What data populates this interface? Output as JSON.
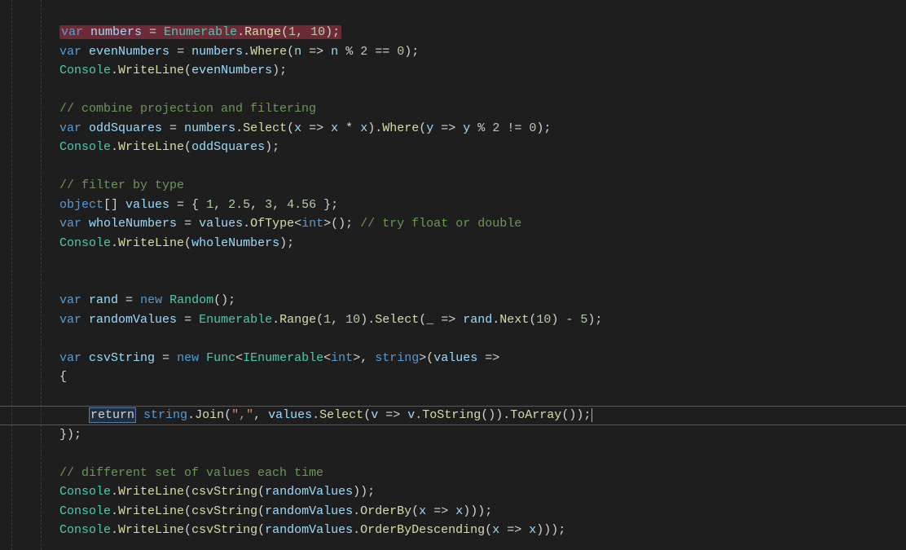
{
  "editor": {
    "language": "csharp",
    "highlight_line_index": 20,
    "lines": [
      [
        {
          "cls": "hl-error",
          "tokens": [
            {
              "cls": "tok-kw",
              "t": "var"
            },
            {
              "cls": "tok-plain",
              "t": " "
            },
            {
              "cls": "tok-id",
              "t": "numbers"
            },
            {
              "cls": "tok-plain",
              "t": " = "
            },
            {
              "cls": "tok-type",
              "t": "Enumerable"
            },
            {
              "cls": "tok-plain",
              "t": "."
            },
            {
              "cls": "tok-method",
              "t": "Range"
            },
            {
              "cls": "tok-plain",
              "t": "("
            },
            {
              "cls": "tok-num",
              "t": "1"
            },
            {
              "cls": "tok-plain",
              "t": ", "
            },
            {
              "cls": "tok-num",
              "t": "10"
            },
            {
              "cls": "tok-plain",
              "t": ");"
            }
          ]
        }
      ],
      [
        {
          "cls": "tok-kw",
          "t": "var"
        },
        {
          "cls": "tok-plain",
          "t": " "
        },
        {
          "cls": "tok-id",
          "t": "evenNumbers"
        },
        {
          "cls": "tok-plain",
          "t": " = "
        },
        {
          "cls": "tok-id",
          "t": "numbers"
        },
        {
          "cls": "tok-plain",
          "t": "."
        },
        {
          "cls": "tok-method",
          "t": "Where"
        },
        {
          "cls": "tok-plain",
          "t": "("
        },
        {
          "cls": "tok-id",
          "t": "n"
        },
        {
          "cls": "tok-plain",
          "t": " => "
        },
        {
          "cls": "tok-id",
          "t": "n"
        },
        {
          "cls": "tok-plain",
          "t": " % "
        },
        {
          "cls": "tok-num",
          "t": "2"
        },
        {
          "cls": "tok-plain",
          "t": " == "
        },
        {
          "cls": "tok-num",
          "t": "0"
        },
        {
          "cls": "tok-plain",
          "t": ");"
        }
      ],
      [
        {
          "cls": "tok-type",
          "t": "Console"
        },
        {
          "cls": "tok-plain",
          "t": "."
        },
        {
          "cls": "tok-method",
          "t": "WriteLine"
        },
        {
          "cls": "tok-plain",
          "t": "("
        },
        {
          "cls": "tok-id",
          "t": "evenNumbers"
        },
        {
          "cls": "tok-plain",
          "t": ");"
        }
      ],
      [],
      [
        {
          "cls": "tok-comment",
          "t": "// combine projection and filtering"
        }
      ],
      [
        {
          "cls": "tok-kw",
          "t": "var"
        },
        {
          "cls": "tok-plain",
          "t": " "
        },
        {
          "cls": "tok-id",
          "t": "oddSquares"
        },
        {
          "cls": "tok-plain",
          "t": " = "
        },
        {
          "cls": "tok-id",
          "t": "numbers"
        },
        {
          "cls": "tok-plain",
          "t": "."
        },
        {
          "cls": "tok-method",
          "t": "Select"
        },
        {
          "cls": "tok-plain",
          "t": "("
        },
        {
          "cls": "tok-id",
          "t": "x"
        },
        {
          "cls": "tok-plain",
          "t": " => "
        },
        {
          "cls": "tok-id",
          "t": "x"
        },
        {
          "cls": "tok-plain",
          "t": " * "
        },
        {
          "cls": "tok-id",
          "t": "x"
        },
        {
          "cls": "tok-plain",
          "t": ")."
        },
        {
          "cls": "tok-method",
          "t": "Where"
        },
        {
          "cls": "tok-plain",
          "t": "("
        },
        {
          "cls": "tok-id",
          "t": "y"
        },
        {
          "cls": "tok-plain",
          "t": " => "
        },
        {
          "cls": "tok-id",
          "t": "y"
        },
        {
          "cls": "tok-plain",
          "t": " % "
        },
        {
          "cls": "tok-num",
          "t": "2"
        },
        {
          "cls": "tok-plain",
          "t": " != "
        },
        {
          "cls": "tok-num",
          "t": "0"
        },
        {
          "cls": "tok-plain",
          "t": ");"
        }
      ],
      [
        {
          "cls": "tok-type",
          "t": "Console"
        },
        {
          "cls": "tok-plain",
          "t": "."
        },
        {
          "cls": "tok-method",
          "t": "WriteLine"
        },
        {
          "cls": "tok-plain",
          "t": "("
        },
        {
          "cls": "tok-id",
          "t": "oddSquares"
        },
        {
          "cls": "tok-plain",
          "t": ");"
        }
      ],
      [],
      [
        {
          "cls": "tok-comment",
          "t": "// filter by type"
        }
      ],
      [
        {
          "cls": "tok-kw",
          "t": "object"
        },
        {
          "cls": "tok-plain",
          "t": "[] "
        },
        {
          "cls": "tok-id",
          "t": "values"
        },
        {
          "cls": "tok-plain",
          "t": " = { "
        },
        {
          "cls": "tok-num",
          "t": "1"
        },
        {
          "cls": "tok-plain",
          "t": ", "
        },
        {
          "cls": "tok-num",
          "t": "2.5"
        },
        {
          "cls": "tok-plain",
          "t": ", "
        },
        {
          "cls": "tok-num",
          "t": "3"
        },
        {
          "cls": "tok-plain",
          "t": ", "
        },
        {
          "cls": "tok-num",
          "t": "4.56"
        },
        {
          "cls": "tok-plain",
          "t": " };"
        }
      ],
      [
        {
          "cls": "tok-kw",
          "t": "var"
        },
        {
          "cls": "tok-plain",
          "t": " "
        },
        {
          "cls": "tok-id",
          "t": "wholeNumbers"
        },
        {
          "cls": "tok-plain",
          "t": " = "
        },
        {
          "cls": "tok-id",
          "t": "values"
        },
        {
          "cls": "tok-plain",
          "t": "."
        },
        {
          "cls": "tok-method",
          "t": "OfType"
        },
        {
          "cls": "tok-plain",
          "t": "<"
        },
        {
          "cls": "tok-kw",
          "t": "int"
        },
        {
          "cls": "tok-plain",
          "t": ">(); "
        },
        {
          "cls": "tok-comment",
          "t": "// try float or double"
        }
      ],
      [
        {
          "cls": "tok-type",
          "t": "Console"
        },
        {
          "cls": "tok-plain",
          "t": "."
        },
        {
          "cls": "tok-method",
          "t": "WriteLine"
        },
        {
          "cls": "tok-plain",
          "t": "("
        },
        {
          "cls": "tok-id",
          "t": "wholeNumbers"
        },
        {
          "cls": "tok-plain",
          "t": ");"
        }
      ],
      [],
      [],
      [
        {
          "cls": "tok-kw",
          "t": "var"
        },
        {
          "cls": "tok-plain",
          "t": " "
        },
        {
          "cls": "tok-id",
          "t": "rand"
        },
        {
          "cls": "tok-plain",
          "t": " = "
        },
        {
          "cls": "tok-kw",
          "t": "new"
        },
        {
          "cls": "tok-plain",
          "t": " "
        },
        {
          "cls": "tok-type",
          "t": "Random"
        },
        {
          "cls": "tok-plain",
          "t": "();"
        }
      ],
      [
        {
          "cls": "tok-kw",
          "t": "var"
        },
        {
          "cls": "tok-plain",
          "t": " "
        },
        {
          "cls": "tok-id",
          "t": "randomValues"
        },
        {
          "cls": "tok-plain",
          "t": " = "
        },
        {
          "cls": "tok-type",
          "t": "Enumerable"
        },
        {
          "cls": "tok-plain",
          "t": "."
        },
        {
          "cls": "tok-method",
          "t": "Range"
        },
        {
          "cls": "tok-plain",
          "t": "("
        },
        {
          "cls": "tok-num",
          "t": "1"
        },
        {
          "cls": "tok-plain",
          "t": ", "
        },
        {
          "cls": "tok-num",
          "t": "10"
        },
        {
          "cls": "tok-plain",
          "t": ")."
        },
        {
          "cls": "tok-method",
          "t": "Select"
        },
        {
          "cls": "tok-plain",
          "t": "("
        },
        {
          "cls": "tok-id",
          "t": "_"
        },
        {
          "cls": "tok-plain",
          "t": " => "
        },
        {
          "cls": "tok-id",
          "t": "rand"
        },
        {
          "cls": "tok-plain",
          "t": "."
        },
        {
          "cls": "tok-method",
          "t": "Next"
        },
        {
          "cls": "tok-plain",
          "t": "("
        },
        {
          "cls": "tok-num",
          "t": "10"
        },
        {
          "cls": "tok-plain",
          "t": ") - "
        },
        {
          "cls": "tok-num",
          "t": "5"
        },
        {
          "cls": "tok-plain",
          "t": ");"
        }
      ],
      [],
      [
        {
          "cls": "tok-kw",
          "t": "var"
        },
        {
          "cls": "tok-plain",
          "t": " "
        },
        {
          "cls": "tok-id",
          "t": "csvString"
        },
        {
          "cls": "tok-plain",
          "t": " = "
        },
        {
          "cls": "tok-kw",
          "t": "new"
        },
        {
          "cls": "tok-plain",
          "t": " "
        },
        {
          "cls": "tok-type",
          "t": "Func"
        },
        {
          "cls": "tok-plain",
          "t": "<"
        },
        {
          "cls": "tok-type",
          "t": "IEnumerable"
        },
        {
          "cls": "tok-plain",
          "t": "<"
        },
        {
          "cls": "tok-kw",
          "t": "int"
        },
        {
          "cls": "tok-plain",
          "t": ">, "
        },
        {
          "cls": "tok-kw",
          "t": "string"
        },
        {
          "cls": "tok-plain",
          "t": ">("
        },
        {
          "cls": "tok-id",
          "t": "values"
        },
        {
          "cls": "tok-plain",
          "t": " =>"
        }
      ],
      [
        {
          "cls": "tok-plain",
          "t": "{"
        }
      ],
      [],
      [
        {
          "cls": "tok-plain",
          "t": "    "
        },
        {
          "cls": "return-box",
          "tokens": [
            {
              "cls": "tok-plain",
              "t": "return"
            }
          ]
        },
        {
          "cls": "tok-plain",
          "t": " "
        },
        {
          "cls": "tok-kw",
          "t": "string"
        },
        {
          "cls": "tok-plain",
          "t": "."
        },
        {
          "cls": "tok-method",
          "t": "Join"
        },
        {
          "cls": "tok-plain",
          "t": "("
        },
        {
          "cls": "tok-str",
          "t": "\",\""
        },
        {
          "cls": "tok-plain",
          "t": ", "
        },
        {
          "cls": "tok-id",
          "t": "values"
        },
        {
          "cls": "tok-plain",
          "t": "."
        },
        {
          "cls": "tok-method",
          "t": "Select"
        },
        {
          "cls": "tok-plain",
          "t": "("
        },
        {
          "cls": "tok-id",
          "t": "v"
        },
        {
          "cls": "tok-plain",
          "t": " => "
        },
        {
          "cls": "tok-id",
          "t": "v"
        },
        {
          "cls": "tok-plain",
          "t": "."
        },
        {
          "cls": "tok-method",
          "t": "ToString"
        },
        {
          "cls": "tok-plain",
          "t": "())."
        },
        {
          "cls": "tok-method",
          "t": "ToArray"
        },
        {
          "cls": "tok-plain",
          "t": "());"
        },
        {
          "cursor": true
        }
      ],
      [
        {
          "cls": "tok-plain",
          "t": "});"
        }
      ],
      [],
      [
        {
          "cls": "tok-comment",
          "t": "// different set of values each time"
        }
      ],
      [
        {
          "cls": "tok-type",
          "t": "Console"
        },
        {
          "cls": "tok-plain",
          "t": "."
        },
        {
          "cls": "tok-method",
          "t": "WriteLine"
        },
        {
          "cls": "tok-plain",
          "t": "("
        },
        {
          "cls": "tok-method",
          "t": "csvString"
        },
        {
          "cls": "tok-plain",
          "t": "("
        },
        {
          "cls": "tok-id",
          "t": "randomValues"
        },
        {
          "cls": "tok-plain",
          "t": "));"
        }
      ],
      [
        {
          "cls": "tok-type",
          "t": "Console"
        },
        {
          "cls": "tok-plain",
          "t": "."
        },
        {
          "cls": "tok-method",
          "t": "WriteLine"
        },
        {
          "cls": "tok-plain",
          "t": "("
        },
        {
          "cls": "tok-method",
          "t": "csvString"
        },
        {
          "cls": "tok-plain",
          "t": "("
        },
        {
          "cls": "tok-id",
          "t": "randomValues"
        },
        {
          "cls": "tok-plain",
          "t": "."
        },
        {
          "cls": "tok-method",
          "t": "OrderBy"
        },
        {
          "cls": "tok-plain",
          "t": "("
        },
        {
          "cls": "tok-id",
          "t": "x"
        },
        {
          "cls": "tok-plain",
          "t": " => "
        },
        {
          "cls": "tok-id",
          "t": "x"
        },
        {
          "cls": "tok-plain",
          "t": ")));"
        }
      ],
      [
        {
          "cls": "tok-type",
          "t": "Console"
        },
        {
          "cls": "tok-plain",
          "t": "."
        },
        {
          "cls": "tok-method",
          "t": "WriteLine"
        },
        {
          "cls": "tok-plain",
          "t": "("
        },
        {
          "cls": "tok-method",
          "t": "csvString"
        },
        {
          "cls": "tok-plain",
          "t": "("
        },
        {
          "cls": "tok-id",
          "t": "randomValues"
        },
        {
          "cls": "tok-plain",
          "t": "."
        },
        {
          "cls": "tok-method",
          "t": "OrderByDescending"
        },
        {
          "cls": "tok-plain",
          "t": "("
        },
        {
          "cls": "tok-id",
          "t": "x"
        },
        {
          "cls": "tok-plain",
          "t": " => "
        },
        {
          "cls": "tok-id",
          "t": "x"
        },
        {
          "cls": "tok-plain",
          "t": ")));"
        }
      ]
    ]
  }
}
